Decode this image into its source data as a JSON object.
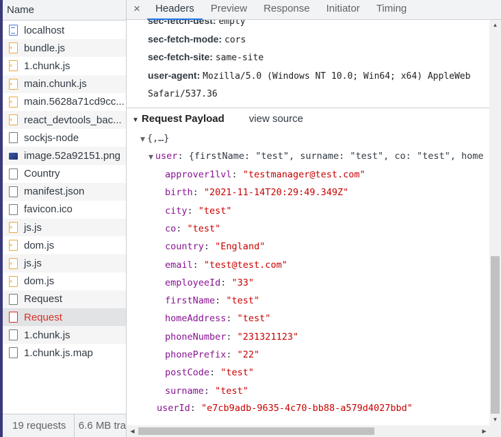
{
  "left_panel": {
    "header": "Name",
    "rows": [
      {
        "label": "localhost",
        "icon": "document-icon"
      },
      {
        "label": "bundle.js",
        "icon": "script-icon"
      },
      {
        "label": "1.chunk.js",
        "icon": "script-icon"
      },
      {
        "label": "main.chunk.js",
        "icon": "script-icon"
      },
      {
        "label": "main.5628a71cd9cc...",
        "icon": "script-icon"
      },
      {
        "label": "react_devtools_bac...",
        "icon": "script-icon"
      },
      {
        "label": "sockjs-node",
        "icon": "file-icon"
      },
      {
        "label": "image.52a92151.png",
        "icon": "image-icon"
      },
      {
        "label": "Country",
        "icon": "file-icon"
      },
      {
        "label": "manifest.json",
        "icon": "file-icon"
      },
      {
        "label": "favicon.ico",
        "icon": "file-icon"
      },
      {
        "label": "js.js",
        "icon": "script-icon"
      },
      {
        "label": "dom.js",
        "icon": "script-icon"
      },
      {
        "label": "js.js",
        "icon": "script-icon"
      },
      {
        "label": "dom.js",
        "icon": "script-icon"
      },
      {
        "label": "Request",
        "icon": "file-icon"
      },
      {
        "label": "Request",
        "icon": "error-file-icon",
        "selected": true,
        "error": true
      },
      {
        "label": "1.chunk.js",
        "icon": "file-icon"
      },
      {
        "label": "1.chunk.js.map",
        "icon": "file-icon"
      }
    ],
    "footer": {
      "requests": "19 requests",
      "size": "6.6 MB tra"
    }
  },
  "tabs": {
    "close": "×",
    "items": [
      "Headers",
      "Preview",
      "Response",
      "Initiator",
      "Timing"
    ],
    "active": "Headers"
  },
  "headers": {
    "partial_top": {
      "key": "sec-fetch-dest:",
      "value": "empty"
    },
    "mode": {
      "key": "sec-fetch-mode:",
      "value": "cors"
    },
    "site": {
      "key": "sec-fetch-site:",
      "value": "same-site"
    },
    "agent": {
      "key": "user-agent:",
      "value": "Mozilla/5.0 (Windows NT 10.0; Win64; x64) AppleWeb"
    },
    "agent_cont": "Safari/537.36"
  },
  "payload": {
    "title": "Request Payload",
    "view_source": "view source",
    "root": "{,…}",
    "user_key": "user",
    "user_preview": "{firstName: \"test\", surname: \"test\", co: \"test\", home",
    "fields": [
      {
        "key": "approver1lvl",
        "value": "\"testmanager@test.com\""
      },
      {
        "key": "birth",
        "value": "\"2021-11-14T20:29:49.349Z\""
      },
      {
        "key": "city",
        "value": "\"test\""
      },
      {
        "key": "co",
        "value": "\"test\""
      },
      {
        "key": "country",
        "value": "\"England\""
      },
      {
        "key": "email",
        "value": "\"test@test.com\""
      },
      {
        "key": "employeeId",
        "value": "\"33\""
      },
      {
        "key": "firstName",
        "value": "\"test\""
      },
      {
        "key": "homeAddress",
        "value": "\"test\""
      },
      {
        "key": "phoneNumber",
        "value": "\"231321123\""
      },
      {
        "key": "phonePrefix",
        "value": "\"22\""
      },
      {
        "key": "postCode",
        "value": "\"test\""
      },
      {
        "key": "surname",
        "value": "\"test\""
      }
    ],
    "userId": {
      "key": "userId",
      "value": "\"e7cb9adb-9635-4c70-bb88-a579d4027bbd\""
    }
  },
  "colors": {
    "key": "#881391",
    "string": "#c80000",
    "accent": "#1a73e8",
    "error": "#d93025"
  }
}
